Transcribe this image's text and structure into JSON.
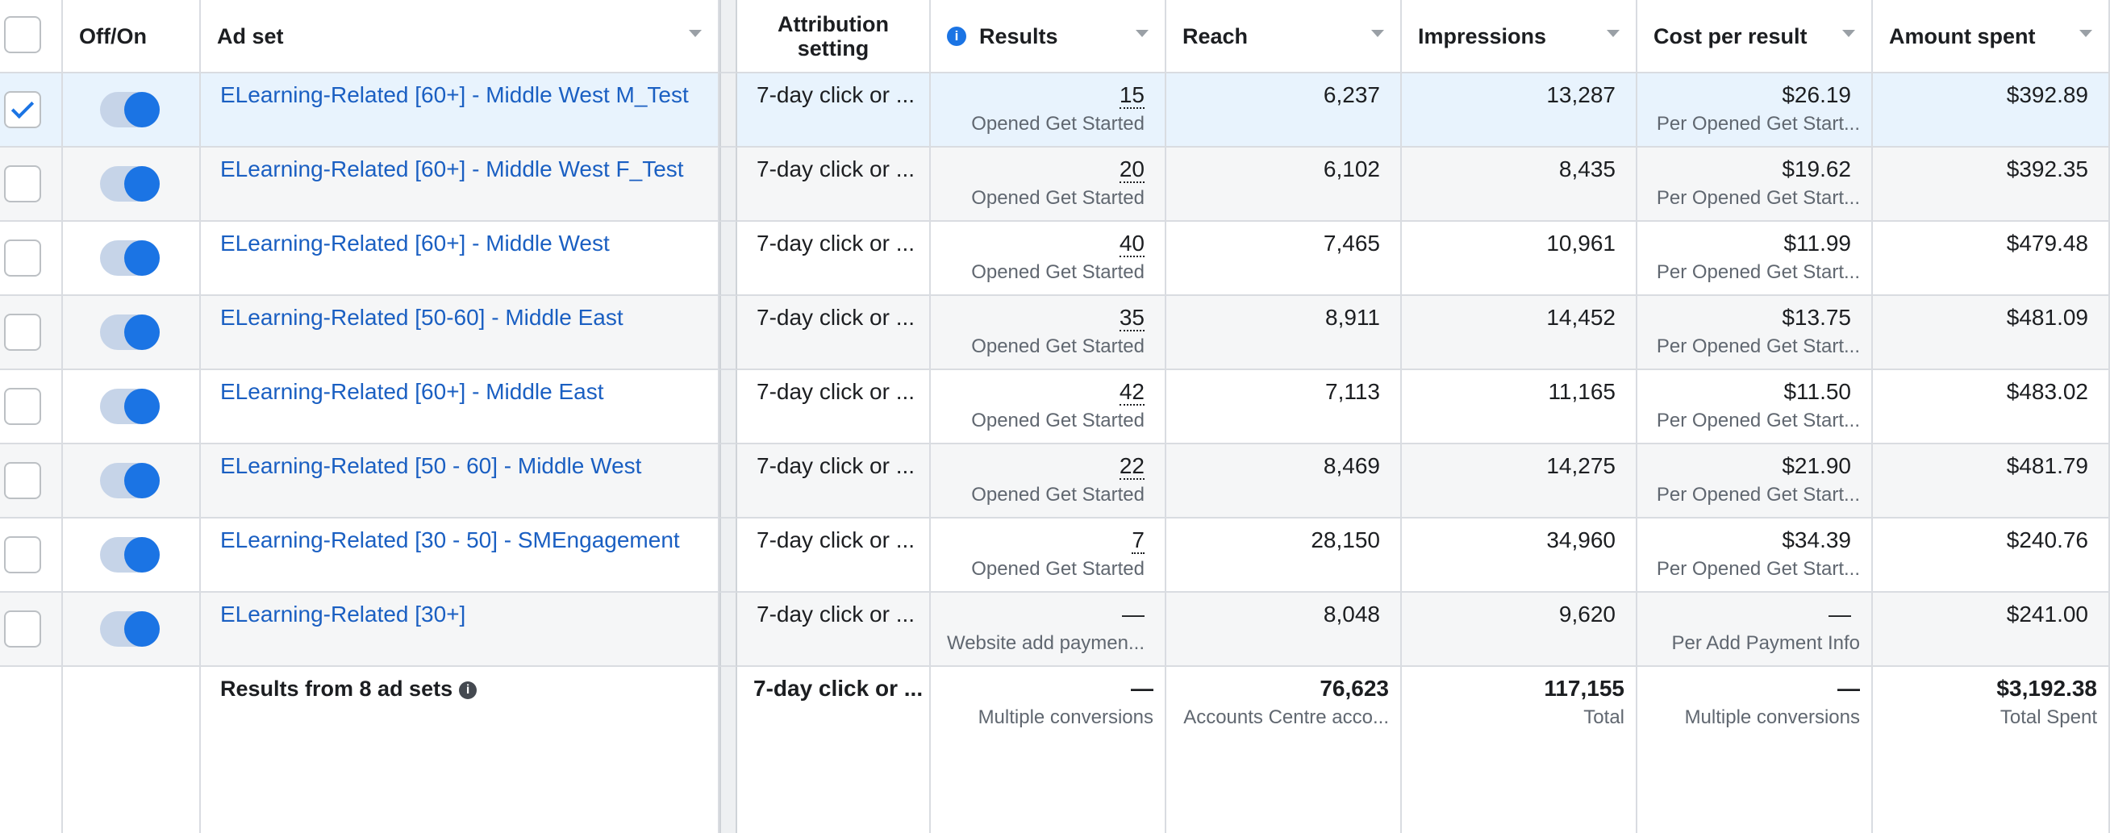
{
  "headers": {
    "off_on": "Off/On",
    "ad_set": "Ad set",
    "attribution": "Attribution setting",
    "results": "Results",
    "reach": "Reach",
    "impressions": "Impressions",
    "cost_per_result": "Cost per result",
    "amount_spent": "Amount spent"
  },
  "rows": [
    {
      "checked": true,
      "on": true,
      "name": "ELearning-Related [60+] - Middle West M_Test",
      "attribution": "7-day click or ...",
      "results": "15",
      "results_sub": "Opened Get Started",
      "reach": "6,237",
      "impressions": "13,287",
      "cost": "$26.19",
      "cost_sub": "Per Opened Get Start...",
      "spent": "$392.89"
    },
    {
      "checked": false,
      "on": true,
      "name": "ELearning-Related [60+] - Middle West F_Test",
      "attribution": "7-day click or ...",
      "results": "20",
      "results_sub": "Opened Get Started",
      "reach": "6,102",
      "impressions": "8,435",
      "cost": "$19.62",
      "cost_sub": "Per Opened Get Start...",
      "spent": "$392.35"
    },
    {
      "checked": false,
      "on": true,
      "name": "ELearning-Related [60+] - Middle West",
      "attribution": "7-day click or ...",
      "results": "40",
      "results_sub": "Opened Get Started",
      "reach": "7,465",
      "impressions": "10,961",
      "cost": "$11.99",
      "cost_sub": "Per Opened Get Start...",
      "spent": "$479.48"
    },
    {
      "checked": false,
      "on": true,
      "name": "ELearning-Related [50-60] - Middle East",
      "attribution": "7-day click or ...",
      "results": "35",
      "results_sub": "Opened Get Started",
      "reach": "8,911",
      "impressions": "14,452",
      "cost": "$13.75",
      "cost_sub": "Per Opened Get Start...",
      "spent": "$481.09"
    },
    {
      "checked": false,
      "on": true,
      "name": "ELearning-Related [60+] - Middle East",
      "attribution": "7-day click or ...",
      "results": "42",
      "results_sub": "Opened Get Started",
      "reach": "7,113",
      "impressions": "11,165",
      "cost": "$11.50",
      "cost_sub": "Per Opened Get Start...",
      "spent": "$483.02"
    },
    {
      "checked": false,
      "on": true,
      "name": "ELearning-Related [50 - 60] - Middle West",
      "attribution": "7-day click or ...",
      "results": "22",
      "results_sub": "Opened Get Started",
      "reach": "8,469",
      "impressions": "14,275",
      "cost": "$21.90",
      "cost_sub": "Per Opened Get Start...",
      "spent": "$481.79"
    },
    {
      "checked": false,
      "on": true,
      "name": "ELearning-Related [30 - 50] - SMEngagement",
      "attribution": "7-day click or ...",
      "results": "7",
      "results_sub": "Opened Get Started",
      "reach": "28,150",
      "impressions": "34,960",
      "cost": "$34.39",
      "cost_sub": "Per Opened Get Start...",
      "spent": "$240.76"
    },
    {
      "checked": false,
      "on": true,
      "name": "ELearning-Related [30+]",
      "attribution": "7-day click or ...",
      "results": "—",
      "results_sub": "Website add paymen...",
      "reach": "8,048",
      "impressions": "9,620",
      "cost": "—",
      "cost_sub": "Per Add Payment Info",
      "spent": "$241.00"
    }
  ],
  "totals": {
    "label": "Results from 8 ad sets",
    "attribution": "7-day click or ...",
    "results": "—",
    "results_sub": "Multiple conversions",
    "reach": "76,623",
    "reach_sub": "Accounts Centre acco...",
    "impressions": "117,155",
    "impressions_sub": "Total",
    "cost": "—",
    "cost_sub": "Multiple conversions",
    "spent": "$3,192.38",
    "spent_sub": "Total Spent"
  },
  "colors": {
    "link": "#1a5fc2",
    "toggle_on": "#1b74e4",
    "selected_row": "#e8f3fd",
    "alt_row": "#f5f6f7"
  },
  "icons": {
    "info": "info-icon",
    "sort": "chevron-down-icon",
    "check": "checkmark-icon"
  }
}
